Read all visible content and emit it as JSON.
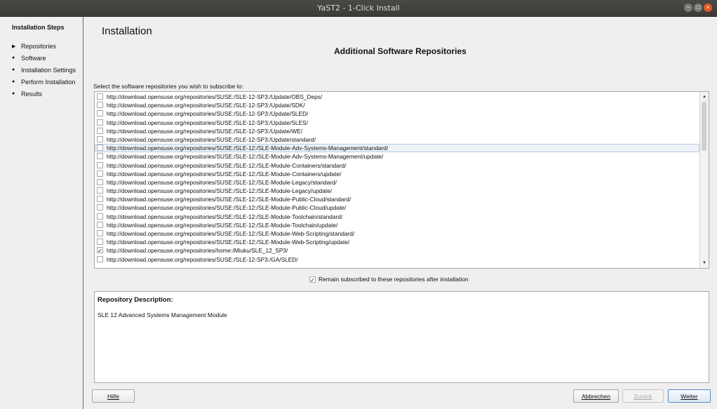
{
  "window": {
    "title": "YaST2 - 1-Click Install"
  },
  "sidebar": {
    "heading": "Installation Steps",
    "steps": [
      {
        "label": "Repositories",
        "marker": "▶"
      },
      {
        "label": "Software",
        "marker": "●"
      },
      {
        "label": "Installation Settings",
        "marker": "●"
      },
      {
        "label": "Perform Installation",
        "marker": "●"
      },
      {
        "label": "Results",
        "marker": "●"
      }
    ]
  },
  "main": {
    "page_title": "Installation",
    "section_title": "Additional Software Repositories",
    "list_label": "Select the software repositories you wish to subscribe to:",
    "repositories": [
      {
        "url": "http://download.opensuse.org/repositories/SUSE:/SLE-12-SP3:/Update/OBS_Deps/",
        "checked": false
      },
      {
        "url": "http://download.opensuse.org/repositories/SUSE:/SLE-12-SP3:/Update/SDK/",
        "checked": false
      },
      {
        "url": "http://download.opensuse.org/repositories/SUSE:/SLE-12-SP3:/Update/SLED/",
        "checked": false
      },
      {
        "url": "http://download.opensuse.org/repositories/SUSE:/SLE-12-SP3:/Update/SLES/",
        "checked": false
      },
      {
        "url": "http://download.opensuse.org/repositories/SUSE:/SLE-12-SP3:/Update/WE/",
        "checked": false
      },
      {
        "url": "http://download.opensuse.org/repositories/SUSE:/SLE-12-SP3:/Update/standard/",
        "checked": false
      },
      {
        "url": "http://download.opensuse.org/repositories/SUSE:/SLE-12:/SLE-Module-Adv-Systems-Management/standard/",
        "checked": false,
        "selected": true
      },
      {
        "url": "http://download.opensuse.org/repositories/SUSE:/SLE-12:/SLE-Module-Adv-Systems-Management/update/",
        "checked": false
      },
      {
        "url": "http://download.opensuse.org/repositories/SUSE:/SLE-12:/SLE-Module-Containers/standard/",
        "checked": false
      },
      {
        "url": "http://download.opensuse.org/repositories/SUSE:/SLE-12:/SLE-Module-Containers/update/",
        "checked": false
      },
      {
        "url": "http://download.opensuse.org/repositories/SUSE:/SLE-12:/SLE-Module-Legacy/standard/",
        "checked": false
      },
      {
        "url": "http://download.opensuse.org/repositories/SUSE:/SLE-12:/SLE-Module-Legacy/update/",
        "checked": false
      },
      {
        "url": "http://download.opensuse.org/repositories/SUSE:/SLE-12:/SLE-Module-Public-Cloud/standard/",
        "checked": false
      },
      {
        "url": "http://download.opensuse.org/repositories/SUSE:/SLE-12:/SLE-Module-Public-Cloud/update/",
        "checked": false
      },
      {
        "url": "http://download.opensuse.org/repositories/SUSE:/SLE-12:/SLE-Module-Toolchain/standard/",
        "checked": false
      },
      {
        "url": "http://download.opensuse.org/repositories/SUSE:/SLE-12:/SLE-Module-Toolchain/update/",
        "checked": false
      },
      {
        "url": "http://download.opensuse.org/repositories/SUSE:/SLE-12:/SLE-Module-Web-Scripting/standard/",
        "checked": false
      },
      {
        "url": "http://download.opensuse.org/repositories/SUSE:/SLE-12:/SLE-Module-Web-Scripting/update/",
        "checked": false
      },
      {
        "url": "http://download.opensuse.org/repositories/home:/Miuku/SLE_12_SP3/",
        "checked": true
      },
      {
        "url": "http://download.opensuse.org/repositories/SUSE:/SLE-12-SP3:/GA/SLED/",
        "checked": false
      }
    ],
    "remain_subscribed": {
      "label": "Remain subscribed to these repositories after installation",
      "checked": true
    },
    "description": {
      "heading": "Repository Description:",
      "text": "SLE 12 Advanced Systems Management Module"
    }
  },
  "buttons": {
    "help": "Hilfe",
    "abort": "Abbrechen",
    "back": "Zurück",
    "next": "Weiter"
  },
  "icons": {
    "checkmark": "✓",
    "scroll_up": "▲",
    "scroll_down": "▼",
    "minimize": "−",
    "maximize": "□",
    "close": "×"
  }
}
